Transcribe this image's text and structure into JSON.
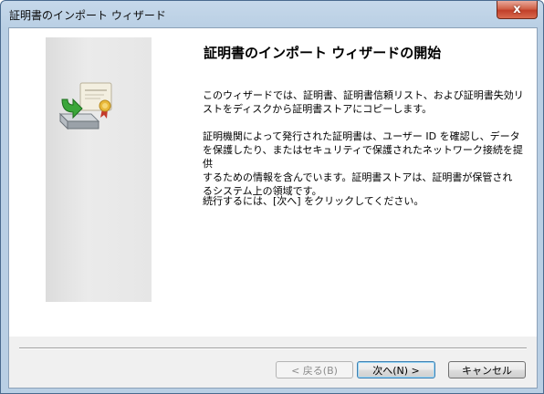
{
  "window": {
    "title": "証明書のインポート ウィザード",
    "close_label": "x"
  },
  "main": {
    "heading": "証明書のインポート ウィザードの開始",
    "paragraph1": "このウィザードでは、証明書、証明書信頼リスト、および証明書失効リ\nストをディスクから証明書ストアにコピーします。",
    "paragraph2": "証明機関によって発行された証明書は、ユーザー ID を確認し、データ\nを保護したり、またはセキュリティで保護されたネットワーク接続を提供\nするための情報を含んでいます。証明書ストアは、証明書が保管され\nるシステム上の領域です。",
    "paragraph3": "続行するには、[次へ] をクリックしてください。"
  },
  "buttons": {
    "back": "< 戻る(B)",
    "next": "次へ(N) >",
    "cancel": "キャンセル"
  },
  "icons": {
    "wizard": "certificate-import-icon",
    "close": "close-icon"
  },
  "colors": {
    "titlebar": "#b9cfe4",
    "close_button": "#c1402a",
    "default_button_border": "#3c7fb1"
  }
}
